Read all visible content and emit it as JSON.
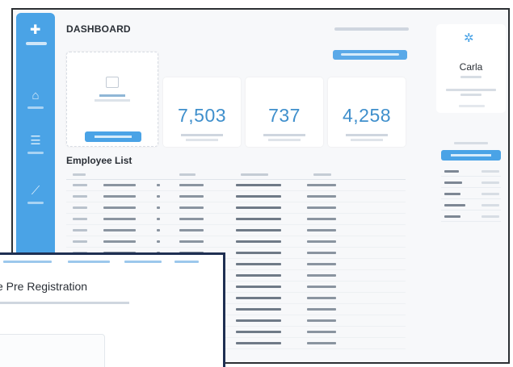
{
  "header": {
    "title": "DASHBOARD"
  },
  "stats": [
    {
      "value": "7,503"
    },
    {
      "value": "737"
    },
    {
      "value": "4,258"
    }
  ],
  "employee_list": {
    "title": "Employee List",
    "row_count": 15
  },
  "profile": {
    "name": "Carla"
  },
  "popup": {
    "title": "e Pre Registration"
  },
  "colors": {
    "accent": "#4aa3e6",
    "stat_number": "#3f8fcc",
    "popup_border": "#1f2f52"
  }
}
